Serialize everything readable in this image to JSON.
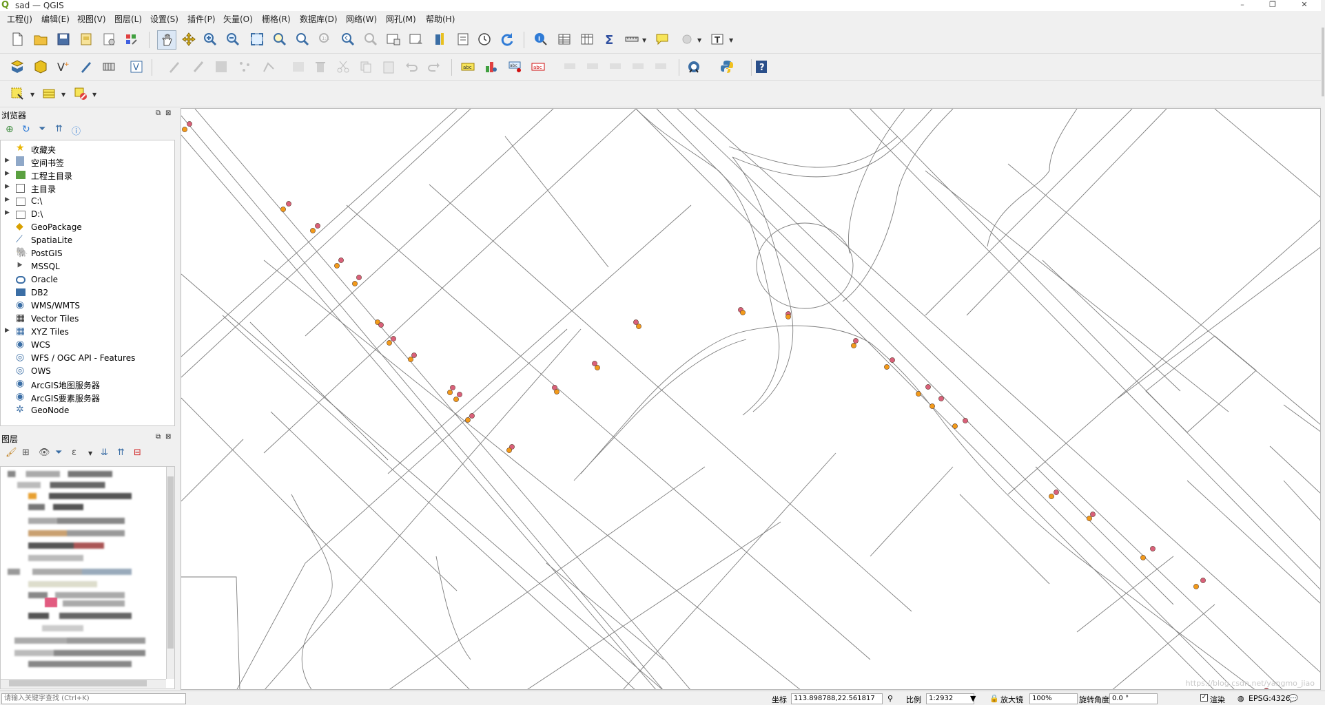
{
  "window": {
    "title": "sad — QGIS",
    "controls": {
      "minimize": "–",
      "maximize": "❐",
      "close": "✕"
    }
  },
  "menubar": {
    "items": [
      "工程(J)",
      "编辑(E)",
      "视图(V)",
      "图层(L)",
      "设置(S)",
      "插件(P)",
      "矢量(O)",
      "栅格(R)",
      "数据库(D)",
      "网络(W)",
      "网孔(M)",
      "帮助(H)"
    ]
  },
  "toolbars": {
    "row1": [
      "new-project-icon",
      "open-project-icon",
      "save-project-icon",
      "new-print-layout-icon",
      "layout-manager-icon",
      "style-manager-icon",
      "pan-icon",
      "pan-to-selection-icon",
      "zoom-in-icon",
      "zoom-out-icon",
      "zoom-full-icon",
      "zoom-to-selection-icon",
      "zoom-to-layer-icon",
      "zoom-native-icon",
      "zoom-last-icon",
      "zoom-next-icon",
      "new-map-view-icon",
      "new-3d-view-icon",
      "temporal-controller-icon",
      "decorations-icon",
      "refresh-icon",
      "identify-icon",
      "open-attribute-table-icon",
      "field-calculator-icon",
      "statistics-icon",
      "measure-icon",
      "map-tips-icon",
      "text-annotation-icon"
    ],
    "row2": [
      "data-source-manager-icon",
      "new-geopackage-layer-icon",
      "new-shapefile-layer-icon",
      "digitize-icon",
      "virtual-layer-icon",
      "toggle-editing-icon",
      "current-edits-icon",
      "save-edits-icon",
      "add-feature-icon",
      "vertex-tool-icon",
      "delete-selected-icon",
      "cut-features-icon",
      "copy-features-icon",
      "paste-features-icon",
      "undo-icon",
      "redo-icon",
      "label-tool-icon",
      "diagram-tool-icon",
      "pin-labels-icon",
      "show-labels-icon",
      "move-label-icon",
      "rotate-label-icon",
      "change-label-icon",
      "geocoding-icon",
      "python-console-icon",
      "help-icon"
    ],
    "row3": [
      "select-features-icon",
      "deselect-icon",
      "select-by-expression-icon"
    ]
  },
  "browser_panel": {
    "title": "浏览器",
    "items": [
      {
        "label": "收藏夹",
        "icon": "favorites-star-icon",
        "expandable": false
      },
      {
        "label": "空间书签",
        "icon": "spatial-bookmarks-icon",
        "expandable": true
      },
      {
        "label": "工程主目录",
        "icon": "project-home-icon",
        "expandable": true
      },
      {
        "label": "主目录",
        "icon": "home-folder-icon",
        "expandable": true
      },
      {
        "label": "C:\\",
        "icon": "drive-c-icon",
        "expandable": true
      },
      {
        "label": "D:\\",
        "icon": "drive-d-icon",
        "expandable": true
      },
      {
        "label": "GeoPackage",
        "icon": "geopackage-icon",
        "expandable": false
      },
      {
        "label": "SpatiaLite",
        "icon": "spatialite-icon",
        "expandable": false
      },
      {
        "label": "PostGIS",
        "icon": "postgis-icon",
        "expandable": false
      },
      {
        "label": "MSSQL",
        "icon": "mssql-icon",
        "expandable": false
      },
      {
        "label": "Oracle",
        "icon": "oracle-icon",
        "expandable": false
      },
      {
        "label": "DB2",
        "icon": "db2-icon",
        "expandable": false
      },
      {
        "label": "WMS/WMTS",
        "icon": "wms-icon",
        "expandable": false
      },
      {
        "label": "Vector Tiles",
        "icon": "vector-tiles-icon",
        "expandable": false
      },
      {
        "label": "XYZ Tiles",
        "icon": "xyz-tiles-icon",
        "expandable": true
      },
      {
        "label": "WCS",
        "icon": "wcs-icon",
        "expandable": false
      },
      {
        "label": "WFS / OGC API - Features",
        "icon": "wfs-icon",
        "expandable": false
      },
      {
        "label": "OWS",
        "icon": "ows-icon",
        "expandable": false
      },
      {
        "label": "ArcGIS地图服务器",
        "icon": "arcgis-map-server-icon",
        "expandable": false
      },
      {
        "label": "ArcGIS要素服务器",
        "icon": "arcgis-feature-server-icon",
        "expandable": false
      },
      {
        "label": "GeoNode",
        "icon": "geonode-icon",
        "expandable": false
      }
    ]
  },
  "layers_panel": {
    "title": "图层"
  },
  "statusbar": {
    "search_placeholder": "请输入关键字查找 (Ctrl+K)",
    "coordinate_label": "坐标",
    "coordinate_value": "113.898788,22.561817",
    "scale_label": "比例",
    "scale_value": "1:2932",
    "magnifier_label": "放大镜",
    "magnifier_value": "100%",
    "rotation_label": "旋转角度",
    "rotation_value": "0.0 °",
    "render_label": "渲染",
    "crs_label": "EPSG:4326",
    "watermark": "https://blog.csdn.net/yangmo_jiao"
  },
  "colors": {
    "marker_pink": "#d9607a",
    "marker_orange": "#f29a1a",
    "road_line": "#7d7d7d"
  }
}
